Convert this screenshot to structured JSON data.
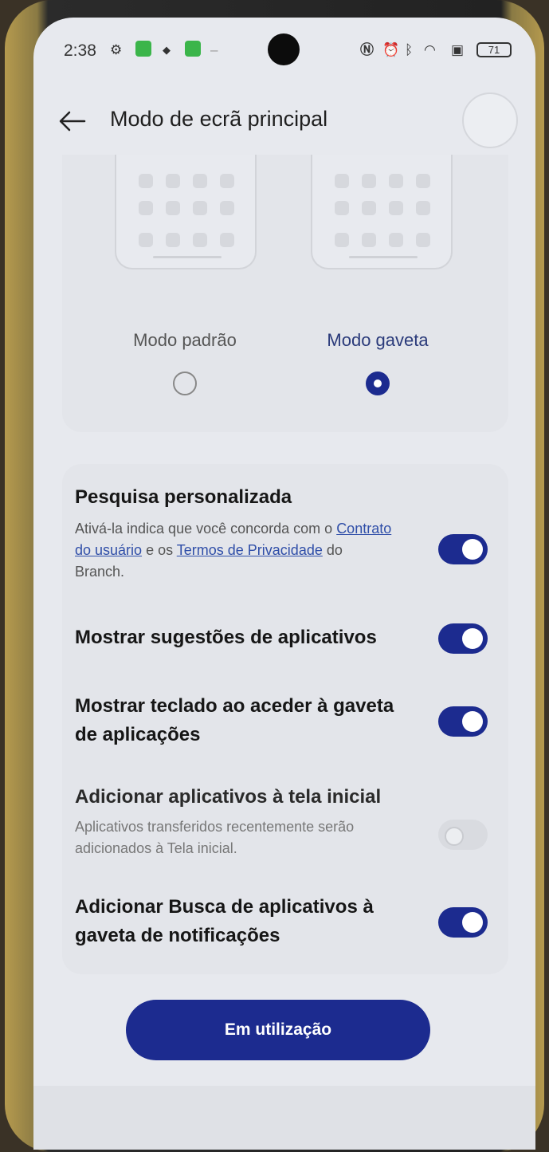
{
  "status_bar": {
    "time": "2:38",
    "battery": "71",
    "left_icons": [
      "settings-gear-icon",
      "green-app-icon",
      "notification-icon",
      "green-app-icon-2",
      "minus-icon"
    ],
    "right_icons": [
      "nfc-icon",
      "alarm-icon",
      "bluetooth-icon",
      "wifi-icon",
      "no-sim-icon"
    ]
  },
  "header": {
    "title": "Modo de ecrã principal"
  },
  "modes": {
    "standard": {
      "label": "Modo padrão",
      "selected": false
    },
    "drawer": {
      "label": "Modo gaveta",
      "selected": true
    }
  },
  "settings": [
    {
      "title": "Pesquisa personalizada",
      "desc_part1": "Ativá-la indica que você concorda com o ",
      "link1": "Contrato do usuário",
      "desc_part2": " e os ",
      "link2": "Termos de Privacidade",
      "desc_part3": " do Branch.",
      "enabled": true
    },
    {
      "title": "Mostrar sugestões de aplicativos",
      "enabled": true
    },
    {
      "title": "Mostrar teclado ao aceder à gaveta de aplicações",
      "enabled": true
    },
    {
      "title": "Adicionar aplicativos à tela inicial",
      "desc": "Aplicativos transferidos recentemente serão adicionados à Tela inicial.",
      "enabled": false
    },
    {
      "title": "Adicionar Busca de aplicativos à gaveta de notificações",
      "enabled": true
    }
  ],
  "main_button": {
    "label": "Em utilização"
  },
  "colors": {
    "accent": "#1c2b8f",
    "background": "#e7e9ee",
    "link": "#2f4ea8"
  }
}
